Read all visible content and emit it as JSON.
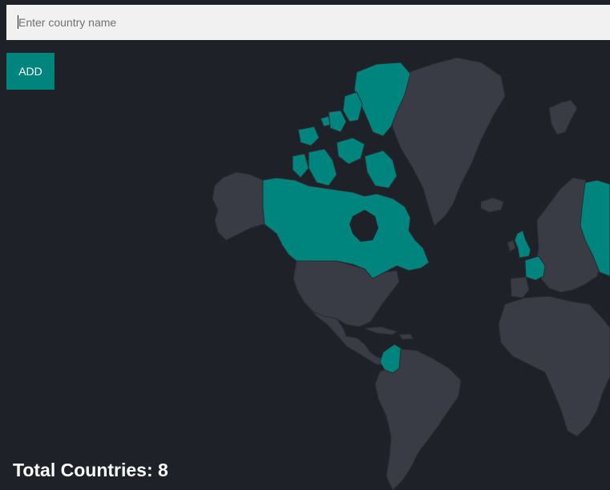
{
  "search": {
    "placeholder": "Enter country name",
    "value": ""
  },
  "add_button": {
    "label": "ADD"
  },
  "total": {
    "label": "Total Countries: ",
    "count": "8"
  },
  "colors": {
    "background": "#1f2128",
    "land": "#3a3c45",
    "visited": "#00857e",
    "border": "#2a2c33",
    "input_bg": "#f1f1f1",
    "button_bg": "#00857e"
  },
  "map": {
    "visited_regions": [
      "Canada",
      "Greenland-Arctic islands",
      "Colombia",
      "United Kingdom",
      "France",
      "Russia"
    ]
  }
}
